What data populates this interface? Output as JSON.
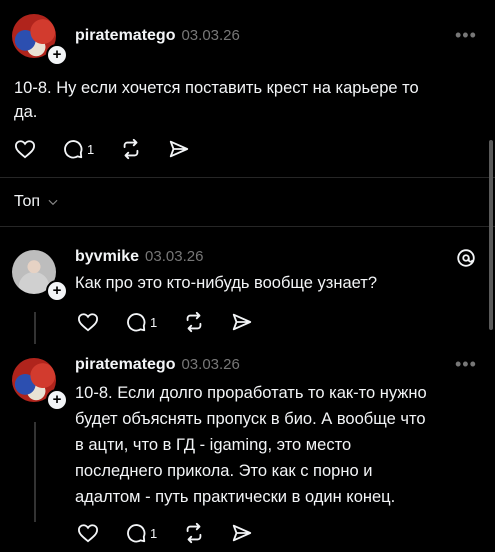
{
  "post": {
    "username": "piratematego",
    "date": "03.03.26",
    "text_line1": "10-8. Ну если хочется поставить крест на карьере то",
    "text_line2": "да.",
    "reply_count": "1"
  },
  "sort": {
    "label": "Топ"
  },
  "comment1": {
    "username": "byvmike",
    "date": "03.03.26",
    "text": "Как про это кто-нибудь вообще узнает?",
    "reply_count": "1"
  },
  "comment2": {
    "username": "piratematego",
    "date": "03.03.26",
    "lines": [
      "10-8. Если долго проработать то как-то нужно",
      "будет объяснять пропуск в био. А вообще что",
      "в ацти, что в ГД - igaming, это место",
      "последнего прикола. Это как с порно и",
      "адалтом - путь практически в один конец."
    ],
    "reply_count": "1"
  },
  "more_label": "•••",
  "plus_label": "+"
}
